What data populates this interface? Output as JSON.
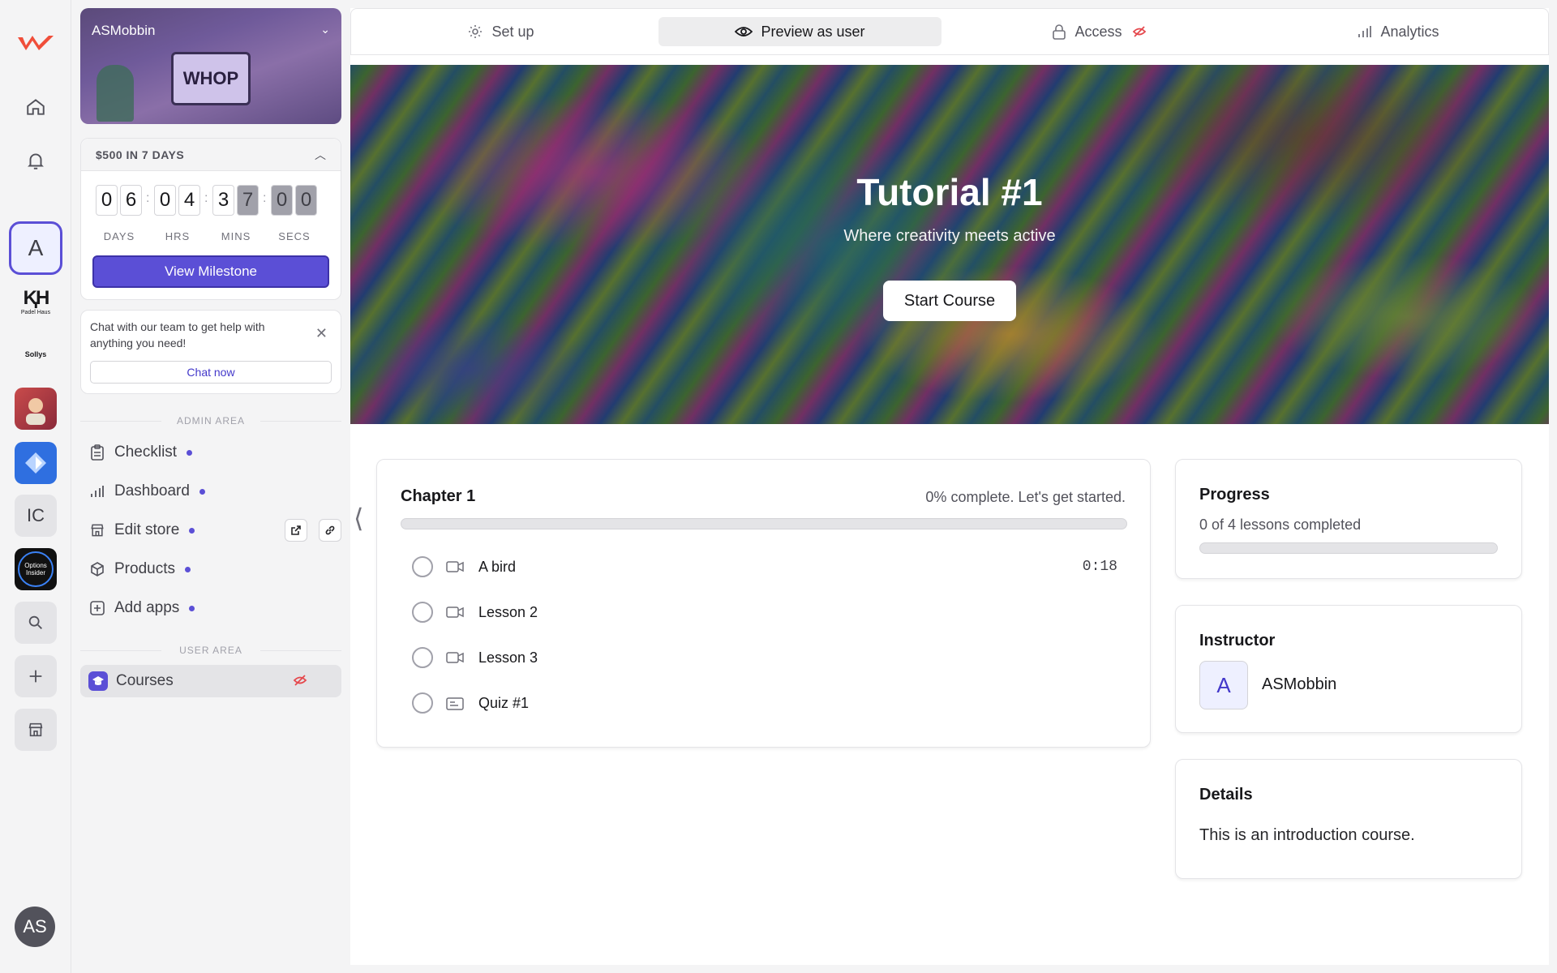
{
  "sidebar_rail": {
    "brand_label": "Padel Haus",
    "brand_small": "Sollys",
    "initial_a": "A",
    "initial_ic": "IC",
    "options_label": "Options Insider",
    "user_initials": "AS"
  },
  "store": {
    "name": "ASMobbin",
    "art_text": "WHOP"
  },
  "milestone": {
    "title": "$500 IN 7 DAYS",
    "days": [
      "0",
      "6"
    ],
    "hrs": [
      "0",
      "4"
    ],
    "mins": [
      "3",
      "7"
    ],
    "secs": [
      "0",
      "0"
    ],
    "labels": {
      "days": "DAYS",
      "hrs": "HRS",
      "mins": "MINS",
      "secs": "SECS"
    },
    "button": "View Milestone"
  },
  "chat": {
    "text": "Chat with our team to get help with anything you need!",
    "button": "Chat now"
  },
  "admin_area": {
    "label": "ADMIN AREA",
    "items": [
      {
        "label": "Checklist"
      },
      {
        "label": "Dashboard"
      },
      {
        "label": "Edit store"
      },
      {
        "label": "Products"
      },
      {
        "label": "Add apps"
      }
    ]
  },
  "user_area": {
    "label": "USER AREA",
    "items": [
      {
        "label": "Courses"
      }
    ]
  },
  "tabs": [
    {
      "label": "Set up",
      "active": false
    },
    {
      "label": "Preview as user",
      "active": true
    },
    {
      "label": "Access",
      "active": false
    },
    {
      "label": "Analytics",
      "active": false
    }
  ],
  "hero": {
    "title": "Tutorial #1",
    "subtitle": "Where creativity meets active",
    "button": "Start Course"
  },
  "chapter": {
    "title": "Chapter 1",
    "status": "0% complete. Let's get started.",
    "progress": 0,
    "lessons": [
      {
        "title": "A bird",
        "duration": "0:18"
      },
      {
        "title": "Lesson 2",
        "duration": ""
      },
      {
        "title": "Lesson 3",
        "duration": ""
      },
      {
        "title": "Quiz #1",
        "duration": ""
      }
    ]
  },
  "progress": {
    "title": "Progress",
    "text": "0 of 4 lessons completed",
    "value": 0
  },
  "instructor": {
    "title": "Instructor",
    "initial": "A",
    "name": "ASMobbin"
  },
  "details": {
    "title": "Details",
    "text": "This is an introduction course."
  },
  "colors": {
    "accent": "#5b4fd6",
    "danger": "#e5484d"
  }
}
